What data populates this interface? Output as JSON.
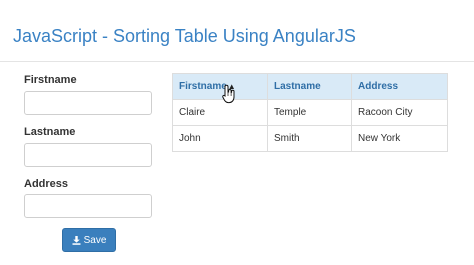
{
  "header": {
    "title": "JavaScript - Sorting Table Using AngularJS"
  },
  "form": {
    "firstname_label": "Firstname",
    "firstname_value": "",
    "lastname_label": "Lastname",
    "lastname_value": "",
    "address_label": "Address",
    "address_value": "",
    "save_label": "Save",
    "save_icon": "download-icon"
  },
  "table": {
    "columns": [
      "Firstname",
      "Lastname",
      "Address"
    ],
    "sort_indicator": "▲",
    "rows": [
      [
        "Claire",
        "Temple",
        "Racoon City"
      ],
      [
        "John",
        "Smith",
        "New York"
      ]
    ]
  },
  "colors": {
    "title": "#3a82c4",
    "header_bg": "#d9eaf7",
    "button_bg": "#3a7fbd"
  },
  "cursor_icon": "hand-pointer-icon"
}
